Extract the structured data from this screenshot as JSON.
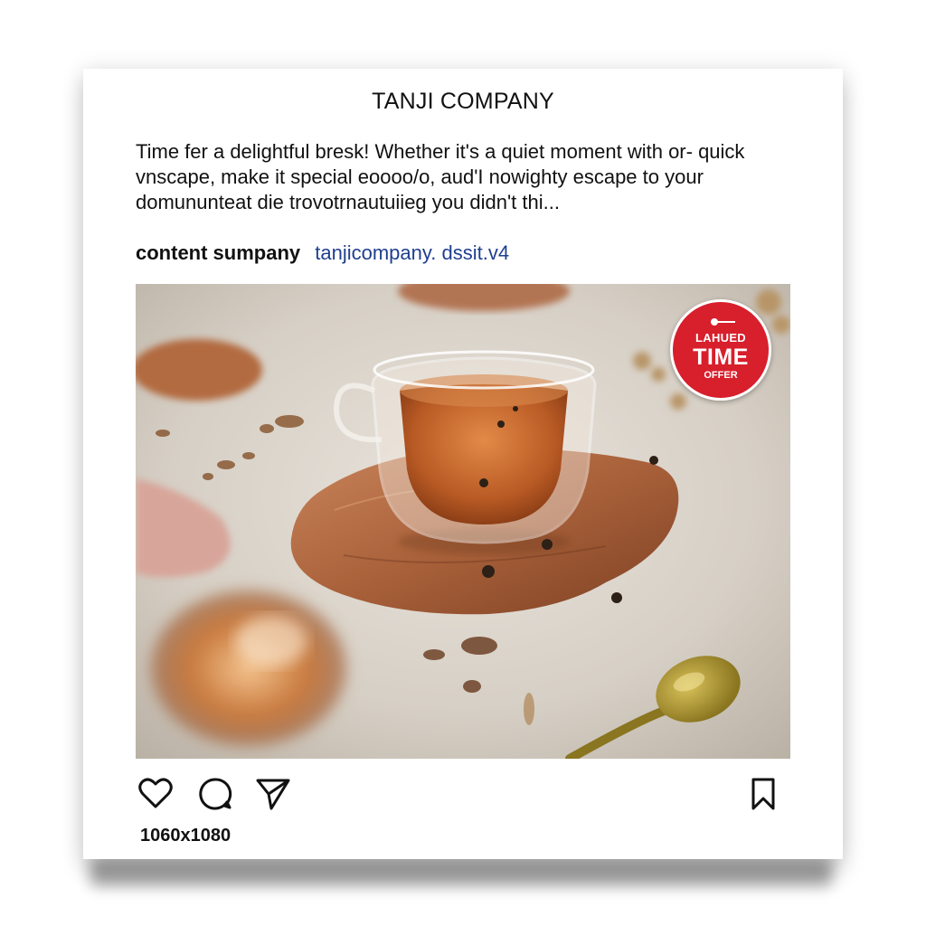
{
  "post": {
    "title": "TANJI COMPANY",
    "caption": "Time fer a delightful bresk! Whether it's a quiet moment with or- quick vnscape, make it special eoooo/o, aud'I nowighty escape to your domununteat die trovotrnautuiieg you didn't thi...",
    "account_name": "content sumpany",
    "account_link": "tanjicompany. dssit.v4",
    "size_label": "1060x1080"
  },
  "badge": {
    "top": "LAHUED",
    "main": "TIME",
    "bottom": "OFFER"
  },
  "actions": {
    "like": "heart-icon",
    "comment": "comment-icon",
    "share": "send-icon",
    "save": "bookmark-icon"
  },
  "colors": {
    "badge": "#d81f2c",
    "link": "#1f3f8f",
    "tea": "#c8682a"
  }
}
